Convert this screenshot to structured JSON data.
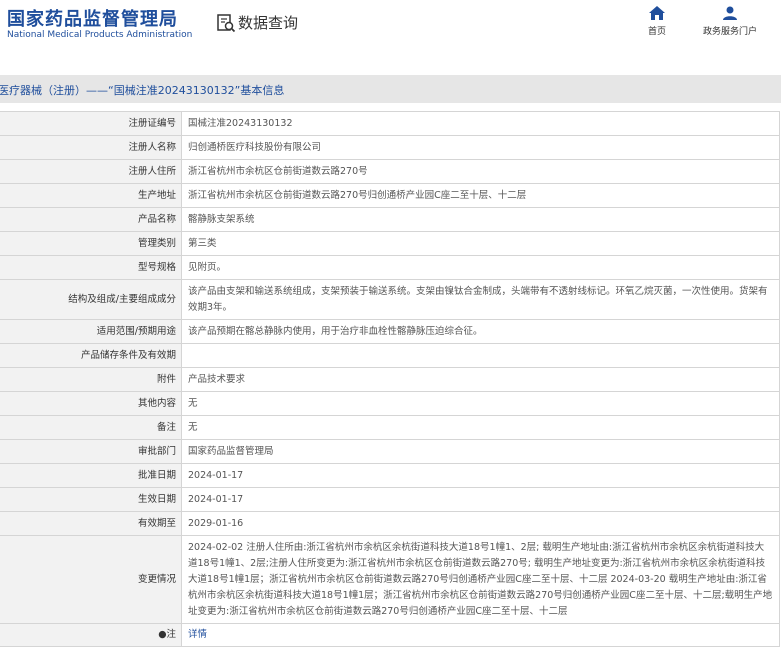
{
  "header": {
    "logo_cn": "国家药品监督管理局",
    "logo_en": "National Medical Products Administration",
    "query_title": "数据查询",
    "nav": [
      {
        "label": "首页",
        "icon": "home-icon"
      },
      {
        "label": "政务服务门户",
        "icon": "user-icon"
      }
    ]
  },
  "title": "医疗器械（注册）——“国械注准20243130132”基本信息",
  "rows": [
    {
      "label": "注册证编号",
      "value": "国械注准20243130132"
    },
    {
      "label": "注册人名称",
      "value": "归创通桥医疗科技股份有限公司"
    },
    {
      "label": "注册人住所",
      "value": "浙江省杭州市余杭区仓前街道数云路270号"
    },
    {
      "label": "生产地址",
      "value": "浙江省杭州市余杭区仓前街道数云路270号归创通桥产业园C座二至十层、十二层"
    },
    {
      "label": "产品名称",
      "value": "髂静脉支架系统"
    },
    {
      "label": "管理类别",
      "value": "第三类"
    },
    {
      "label": "型号规格",
      "value": "见附页。"
    },
    {
      "label": "结构及组成/主要组成成分",
      "value": "该产品由支架和输送系统组成，支架预装于输送系统。支架由镍钛合金制成，头端带有不透射线标记。环氧乙烷灭菌，一次性使用。货架有效期3年。"
    },
    {
      "label": "适用范围/预期用途",
      "value": "该产品预期在髂总静脉内使用，用于治疗非血栓性髂静脉压迫综合征。"
    },
    {
      "label": "产品储存条件及有效期",
      "value": ""
    },
    {
      "label": "附件",
      "value": "产品技术要求"
    },
    {
      "label": "其他内容",
      "value": "无"
    },
    {
      "label": "备注",
      "value": "无"
    },
    {
      "label": "审批部门",
      "value": "国家药品监督管理局"
    },
    {
      "label": "批准日期",
      "value": "2024-01-17"
    },
    {
      "label": "生效日期",
      "value": "2024-01-17"
    },
    {
      "label": "有效期至",
      "value": "2029-01-16"
    },
    {
      "label": "变更情况",
      "value": "2024-02-02 注册人住所由:浙江省杭州市余杭区余杭街道科技大道18号1幢1、2层; 载明生产地址由:浙江省杭州市余杭区余杭街道科技大道18号1幢1、2层;注册人住所变更为:浙江省杭州市余杭区仓前街道数云路270号; 载明生产地址变更为:浙江省杭州市余杭区余杭街道科技大道18号1幢1层；浙江省杭州市余杭区仓前街道数云路270号归创通桥产业园C座二至十层、十二层 2024-03-20 载明生产地址由:浙江省杭州市余杭区余杭街道科技大道18号1幢1层；浙江省杭州市余杭区仓前街道数云路270号归创通桥产业园C座二至十层、十二层;载明生产地址变更为:浙江省杭州市余杭区仓前街道数云路270号归创通桥产业园C座二至十层、十二层"
    },
    {
      "label": "●注",
      "value": "详情"
    }
  ]
}
